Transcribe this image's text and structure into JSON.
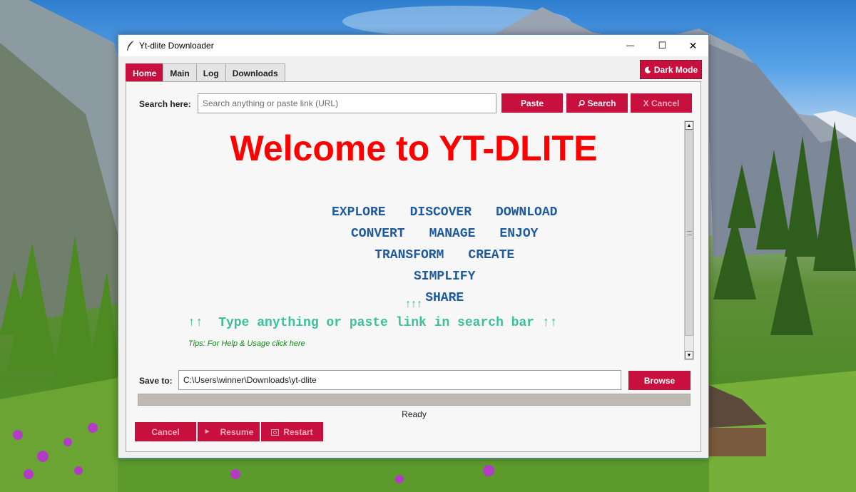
{
  "window": {
    "title": "Yt-dlite Downloader",
    "minimize_glyph": "—",
    "maximize_glyph": "☐",
    "close_glyph": "✕"
  },
  "tabs": [
    {
      "label": "Home",
      "active": true
    },
    {
      "label": "Main",
      "active": false
    },
    {
      "label": "Log",
      "active": false
    },
    {
      "label": "Downloads",
      "active": false
    }
  ],
  "dark_mode": {
    "label": "Dark Mode",
    "icon": "moon-icon"
  },
  "search": {
    "label": "Search here:",
    "placeholder": "Search anything or paste link (URL)",
    "value": "",
    "paste_label": "Paste",
    "search_label": "Search",
    "search_icon": "magnifier-icon",
    "cancel_label": "X Cancel"
  },
  "welcome": {
    "title": "Welcome to YT-DLITE",
    "lines": [
      [
        "EXPLORE",
        "DISCOVER",
        "DOWNLOAD"
      ],
      [
        "CONVERT",
        "MANAGE",
        "ENJOY"
      ],
      [
        "TRANSFORM",
        "CREATE"
      ],
      [
        "SIMPLIFY"
      ],
      [
        "SHARE"
      ]
    ],
    "arrows": "↑↑↑",
    "type_hint": "↑↑  Type anything or paste link in search bar ↑↑",
    "tips": "Tips: For Help & Usage click here"
  },
  "save": {
    "label": "Save to:",
    "path": "C:\\Users\\winner\\Downloads\\yt-dlite",
    "browse_label": "Browse"
  },
  "progress": {
    "fraction": 0.0
  },
  "status": "Ready",
  "controls": {
    "cancel_label": "Cancel",
    "resume_label": "Resume",
    "resume_icon": "play-icon",
    "restart_label": "Restart",
    "restart_icon": "restart-icon"
  },
  "colors": {
    "accent": "#c8103e",
    "welcome_title": "#ff0000",
    "words": "#1f5a9c",
    "hint": "#3bc098",
    "tips": "#0c8a12"
  }
}
